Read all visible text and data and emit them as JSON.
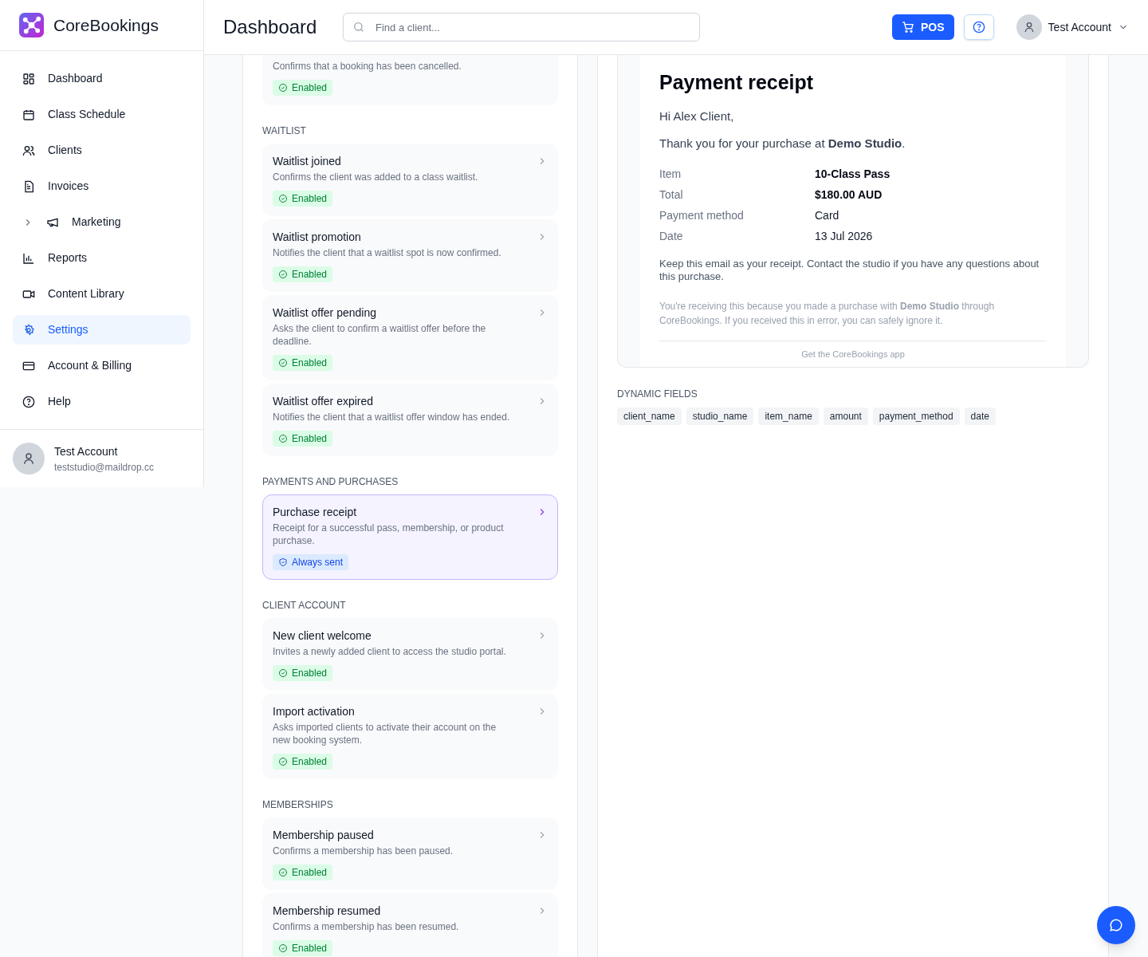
{
  "brand": {
    "name": "CoreBookings"
  },
  "sidebar": {
    "items": [
      {
        "label": "Dashboard",
        "selected": false,
        "expandable": false
      },
      {
        "label": "Class Schedule",
        "selected": false,
        "expandable": false
      },
      {
        "label": "Clients",
        "selected": false,
        "expandable": false
      },
      {
        "label": "Invoices",
        "selected": false,
        "expandable": false
      },
      {
        "label": "Marketing",
        "selected": false,
        "expandable": true
      },
      {
        "label": "Reports",
        "selected": false,
        "expandable": false
      },
      {
        "label": "Content Library",
        "selected": false,
        "expandable": false
      },
      {
        "label": "Settings",
        "selected": true,
        "expandable": false
      },
      {
        "label": "Account & Billing",
        "selected": false,
        "expandable": false
      },
      {
        "label": "Help",
        "selected": false,
        "expandable": false
      }
    ],
    "user": {
      "name": "Test Account",
      "email": "teststudio@maildrop.cc"
    }
  },
  "header": {
    "title": "Dashboard",
    "search": {
      "placeholder": "Find a client..."
    },
    "pos_button": "POS",
    "account": "Test Account"
  },
  "templates": [
    {
      "items": [
        {
          "description": "Confirms that a booking has been cancelled.",
          "kind": "enabled",
          "badge": "Enabled",
          "selected": false
        }
      ]
    },
    {
      "section": "WAITLIST",
      "items": [
        {
          "title": "Waitlist joined",
          "description": "Confirms the client was added to a class waitlist.",
          "kind": "enabled",
          "badge": "Enabled",
          "selected": false
        },
        {
          "title": "Waitlist promotion",
          "description": "Notifies the client that a waitlist spot is now confirmed.",
          "kind": "enabled",
          "badge": "Enabled",
          "selected": false
        },
        {
          "title": "Waitlist offer pending",
          "description": "Asks the client to confirm a waitlist offer before the deadline.",
          "kind": "enabled",
          "badge": "Enabled",
          "selected": false
        },
        {
          "title": "Waitlist offer expired",
          "description": "Notifies the client that a waitlist offer window has ended.",
          "kind": "enabled",
          "badge": "Enabled",
          "selected": false
        }
      ]
    },
    {
      "section": "PAYMENTS AND PURCHASES",
      "items": [
        {
          "title": "Purchase receipt",
          "description": "Receipt for a successful pass, membership, or product purchase.",
          "kind": "always_sent",
          "badge": "Always sent",
          "selected": true
        }
      ]
    },
    {
      "section": "CLIENT ACCOUNT",
      "items": [
        {
          "title": "New client welcome",
          "description": "Invites a newly added client to access the studio portal.",
          "kind": "enabled",
          "badge": "Enabled",
          "selected": false
        },
        {
          "title": "Import activation",
          "description": "Asks imported clients to activate their account on the new booking system.",
          "kind": "enabled",
          "badge": "Enabled",
          "selected": false
        }
      ]
    },
    {
      "section": "MEMBERSHIPS",
      "items": [
        {
          "title": "Membership paused",
          "description": "Confirms a membership has been paused.",
          "kind": "enabled",
          "badge": "Enabled",
          "selected": false
        },
        {
          "title": "Membership resumed",
          "description": "Confirms a membership has been resumed.",
          "kind": "enabled",
          "badge": "Enabled",
          "selected": false
        }
      ]
    }
  ],
  "preview": {
    "heading": "Payment receipt",
    "greeting": "Hi Alex Client,",
    "intro": "Thank you for your purchase at **Demo Studio**.",
    "details": [
      {
        "label": "Item",
        "value": "10-Class Pass",
        "bold": true
      },
      {
        "label": "Total",
        "value": "$180.00 AUD",
        "bold": true
      },
      {
        "label": "Payment method",
        "value": "Card",
        "bold": false
      },
      {
        "label": "Date",
        "value": "13 Jul 2026",
        "bold": false
      }
    ],
    "note": "Keep this email as your receipt. Contact the studio if you have any questions about this purchase.",
    "footer": "You're receiving this because you made a purchase with **Demo Studio** through CoreBookings. If you received this in error, you can safely ignore it.",
    "app_link": "Get the CoreBookings app"
  },
  "dynamic_fields": {
    "title": "DYNAMIC FIELDS",
    "fields": [
      "client_name",
      "studio_name",
      "item_name",
      "amount",
      "payment_method",
      "date"
    ]
  }
}
